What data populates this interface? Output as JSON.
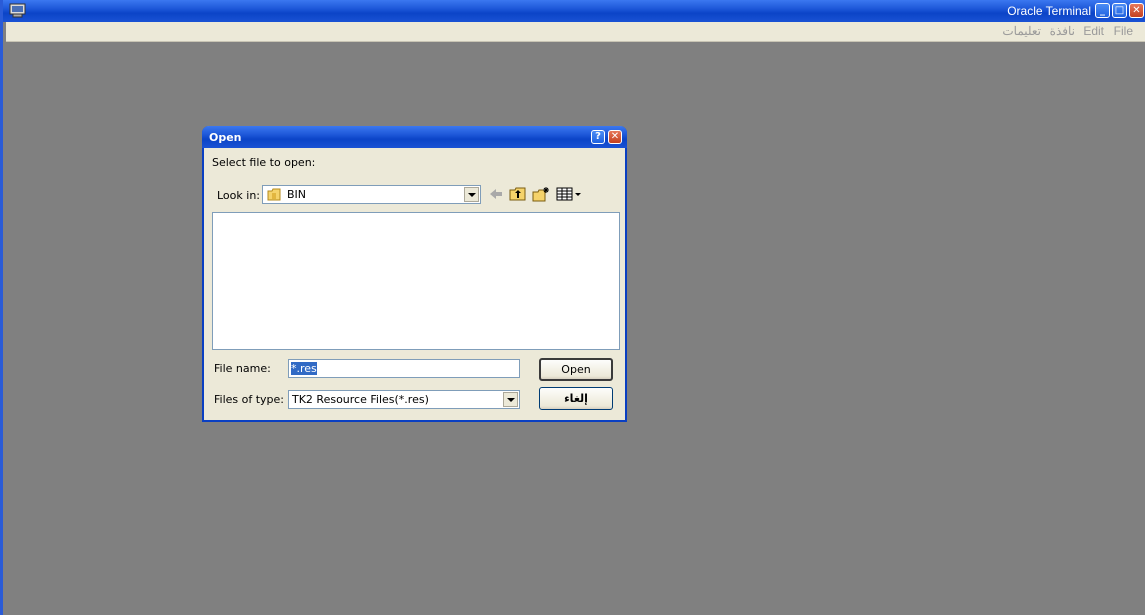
{
  "app": {
    "title": "Oracle Terminal",
    "window_buttons": {
      "minimize": "_",
      "maximize": "□",
      "close": "✕"
    }
  },
  "menubar": {
    "items": [
      "File",
      "Edit",
      "نافذة",
      "تعليمات"
    ]
  },
  "dialog": {
    "title": "Open",
    "help_button": "?",
    "close_button": "✕",
    "prompt": "Select file to open:",
    "look_in_label": "Look in:",
    "look_in_value": "BIN",
    "toolbar_icons": [
      "back-icon",
      "up-folder-icon",
      "new-folder-icon",
      "view-menu-icon"
    ],
    "file_list": [],
    "file_name_label": "File name:",
    "file_name_value": "*.res",
    "files_of_type_label": "Files of type:",
    "files_of_type_value": "TK2 Resource Files(*.res)",
    "open_button": "Open",
    "cancel_button": "إلغاء"
  },
  "colors": {
    "titlebar": "#0b44c7",
    "workspace": "#808080",
    "dialog_face": "#ece9d8",
    "selection": "#316ac5"
  }
}
